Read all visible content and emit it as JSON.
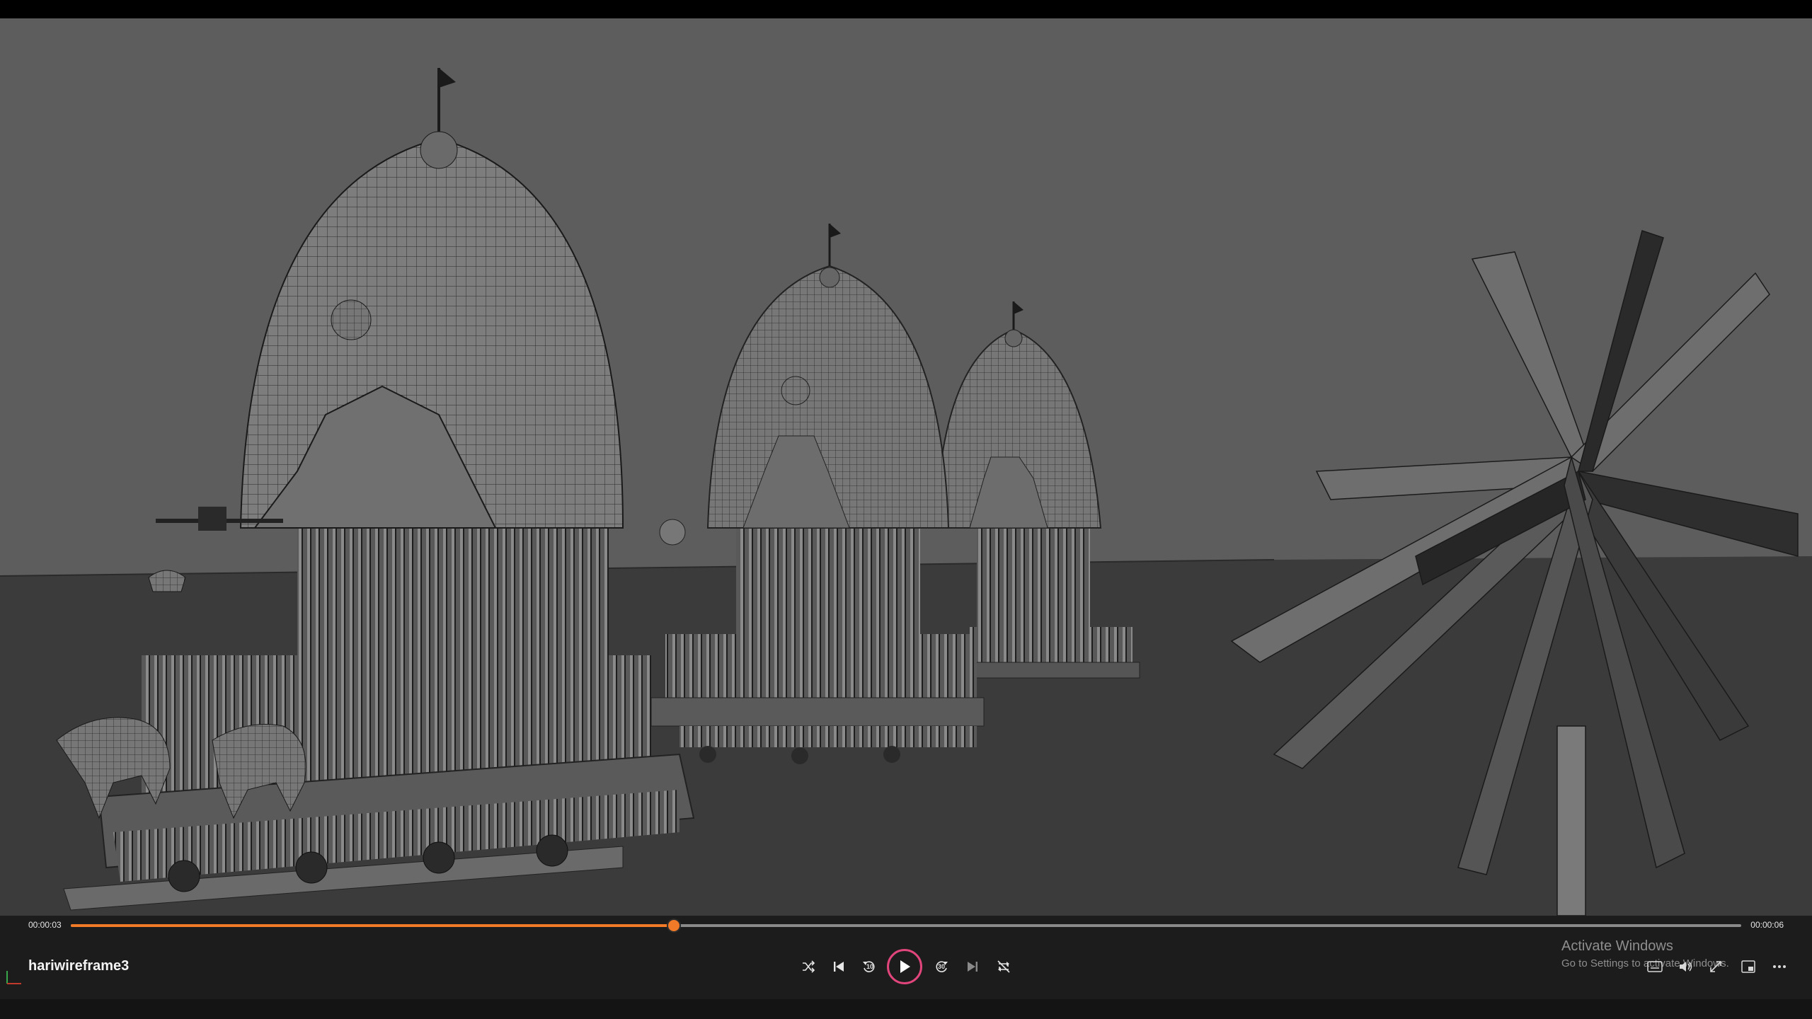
{
  "player": {
    "title": "hariwireframe3",
    "current_time": "00:00:03",
    "total_time": "00:00:06",
    "progress": 0.361,
    "accent_color": "#f07a28",
    "play_ring_color": "#e0457b",
    "skip_back_seconds": "10",
    "skip_forward_seconds": "30"
  },
  "controls": [
    {
      "name": "shuffle-icon"
    },
    {
      "name": "previous-track-icon"
    },
    {
      "name": "skip-back-10-icon"
    },
    {
      "name": "play-icon"
    },
    {
      "name": "skip-forward-30-icon"
    },
    {
      "name": "next-track-icon"
    },
    {
      "name": "repeat-off-icon"
    }
  ],
  "right_controls": [
    {
      "name": "captions-icon"
    },
    {
      "name": "volume-icon"
    },
    {
      "name": "fullscreen-icon"
    },
    {
      "name": "mini-player-icon"
    },
    {
      "name": "more-options-icon"
    }
  ],
  "watermark": {
    "title": "Activate Windows",
    "subtitle": "Go to Settings to activate Windows."
  },
  "scene": {
    "background_color": "#5d5d5d",
    "ground_color": "#3b3b3b",
    "objects": [
      "chariot-large",
      "chariot-medium",
      "chariot-small",
      "palm-tree"
    ]
  }
}
